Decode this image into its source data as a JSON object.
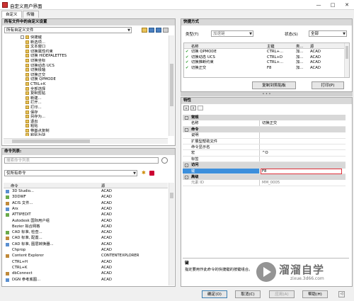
{
  "window": {
    "title": "自定义用户界面",
    "controls": [
      "—",
      "□",
      "✕"
    ]
  },
  "tabs": [
    "自定义",
    "传输"
  ],
  "customizations": {
    "header": "所有文件中的自定义设置",
    "combo_value": "所有自定义文件",
    "tree_items": [
      {
        "indent": 2,
        "label": "快捷键",
        "box": "-"
      },
      {
        "indent": 3,
        "label": "新选项..."
      },
      {
        "indent": 3,
        "label": "文本窗口"
      },
      {
        "indent": 3,
        "label": "切换属性约束"
      },
      {
        "indent": 3,
        "label": "切换 HIDEPALETTES"
      },
      {
        "indent": 3,
        "label": "切换坐标"
      },
      {
        "indent": 3,
        "label": "切换动态 UCS"
      },
      {
        "indent": 3,
        "label": "切换极轴"
      },
      {
        "indent": 3,
        "label": "切换正交"
      },
      {
        "indent": 3,
        "label": "切换 QPMODE"
      },
      {
        "indent": 3,
        "label": "CTRL+K"
      },
      {
        "indent": 3,
        "label": "全部选择"
      },
      {
        "indent": 3,
        "label": "复制剪贴"
      },
      {
        "indent": 3,
        "label": "新建..."
      },
      {
        "indent": 3,
        "label": "打开..."
      },
      {
        "indent": 3,
        "label": "打印..."
      },
      {
        "indent": 3,
        "label": "保存"
      },
      {
        "indent": 3,
        "label": "另存为..."
      },
      {
        "indent": 3,
        "label": "退出"
      },
      {
        "indent": 3,
        "label": "粘贴"
      },
      {
        "indent": 3,
        "label": "带基点复制"
      },
      {
        "indent": 3,
        "label": "粘贴为块"
      },
      {
        "indent": 3,
        "label": "剪切"
      },
      {
        "indent": 3,
        "label": "重复"
      }
    ]
  },
  "command_list": {
    "header": "命令列表:",
    "search_placeholder": "搜索命令列表",
    "filter_value": "仅所有命令",
    "col_command": "命令",
    "col_source": "源",
    "rows": [
      {
        "icon": "3d-icon",
        "name": "3D Studio...",
        "source": "ACAD"
      },
      {
        "icon": "dwf-icon",
        "name": "3DDWF",
        "source": "ACAD"
      },
      {
        "icon": "acis-icon",
        "name": "ACIS 文件...",
        "source": "ACAD"
      },
      {
        "icon": "arx-icon",
        "name": "Arx",
        "source": "ACAD"
      },
      {
        "icon": "attipedit-icon",
        "name": "ATTIPEDIT",
        "source": "ACAD"
      },
      {
        "icon": "",
        "name": "Autodesk 国际用户组",
        "source": "ACAD"
      },
      {
        "icon": "",
        "name": "Bezier 拟合网格",
        "source": "ACAD"
      },
      {
        "icon": "cad-check-icon",
        "name": "CAD 标准, 检查...",
        "source": "ACAD"
      },
      {
        "icon": "cad-config-icon",
        "name": "CAD 标准, 配置...",
        "source": "ACAD"
      },
      {
        "icon": "cad-layer-icon",
        "name": "CAD 标准, 图层转换器...",
        "source": "ACAD"
      },
      {
        "icon": "",
        "name": "Chprop",
        "source": "ACAD"
      },
      {
        "icon": "content-explorer-icon",
        "name": "Content Explorer",
        "source": "CONTENTEXPLORER"
      },
      {
        "icon": "",
        "name": "CTRL+H",
        "source": "ACAD"
      },
      {
        "icon": "",
        "name": "CTRL+K",
        "source": "ACAD"
      },
      {
        "icon": "dbconnect-icon",
        "name": "dbConnect",
        "source": "ACAD"
      },
      {
        "icon": "dgn-icon",
        "name": "DGN 参考底图...",
        "source": "ACAD"
      }
    ]
  },
  "shortcuts": {
    "header": "快捷方式",
    "type_label": "类型(T)",
    "type_value": "加速键",
    "status_label": "状态(S)",
    "status_value": "全部",
    "col_name": "名称",
    "col_key": "主键",
    "col_type": "类...",
    "col_source": "源",
    "rows": [
      {
        "name": "切换 QPMODE",
        "key": "CTRL+...",
        "type": "加...",
        "source": "ACAD"
      },
      {
        "name": "切换动态 UCS",
        "key": "CTRL+D",
        "type": "加...",
        "source": "ACAD"
      },
      {
        "name": "切换推断约束",
        "key": "CTRL+...",
        "type": "加...",
        "source": "ACAD"
      },
      {
        "name": "切换正交",
        "key": "F8",
        "type": "加...",
        "source": "ACAD"
      }
    ],
    "copy_button": "复制到剪贴板",
    "print_button": "打印(P)"
  },
  "properties": {
    "header": "特性",
    "sections": {
      "general": "常规",
      "command": "命令",
      "access": "访问",
      "advanced": "高级"
    },
    "rows": {
      "name_label": "名称",
      "name_value": "切换正交",
      "desc_label": "说明",
      "desc_value": "",
      "help_label": "扩展型帮助文件",
      "help_value": "",
      "cmd_label": "命令显示名",
      "cmd_value": "",
      "macro_label": "宏",
      "macro_value": "^O",
      "tags_label": "标签",
      "tags_value": "",
      "key_label": "键",
      "key_value": "F8",
      "elemid_label": "元素 ID",
      "elemid_value": "MM_0005"
    },
    "desc_title": "键",
    "desc_text": "指定要用作此命令的快捷键的按键组合。"
  },
  "footer": {
    "ok": "确定(O)",
    "cancel": "取消(C)",
    "apply": "应用(A)",
    "help": "帮助(H)"
  },
  "watermark": {
    "brand": "溜溜自学",
    "url": "zixue.3d66.com"
  }
}
